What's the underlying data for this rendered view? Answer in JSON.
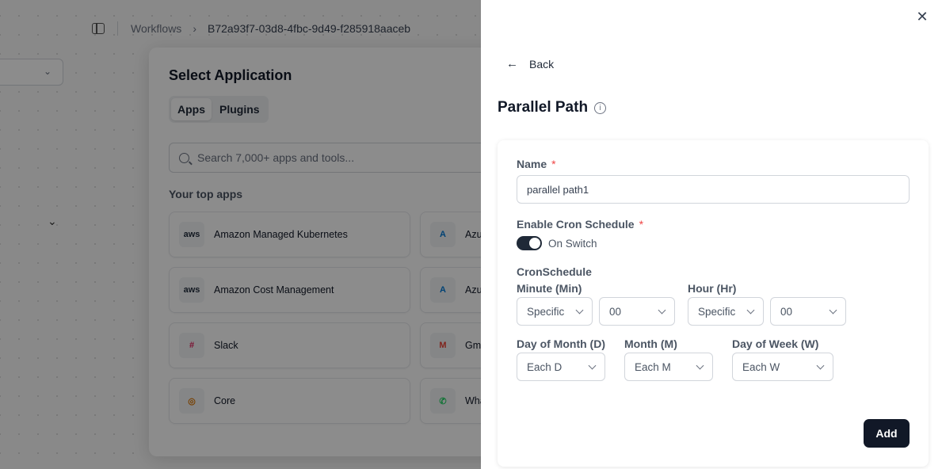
{
  "breadcrumb": {
    "workflows": "Workflows",
    "separator": "›",
    "workflow_id": "B72a93f7-03d8-4fbc-9d49-f285918aaceb"
  },
  "modal": {
    "title": "Select Application",
    "tabs": [
      {
        "label": "Apps"
      },
      {
        "label": "Plugins"
      }
    ],
    "search_placeholder": "Search 7,000+ apps and tools...",
    "top_apps_label": "Your top apps",
    "apps": [
      {
        "name": "Amazon Managed Kubernetes",
        "icon_text": "aws"
      },
      {
        "name": "Azu",
        "icon_text": "A"
      },
      {
        "name": "Amazon Cost Management",
        "icon_text": "aws"
      },
      {
        "name": "Azu",
        "icon_text": "A"
      },
      {
        "name": "Slack",
        "icon_text": "#"
      },
      {
        "name": "Gm",
        "icon_text": "M"
      },
      {
        "name": "Core",
        "icon_text": "◎"
      },
      {
        "name": "Wha",
        "icon_text": "✆"
      }
    ]
  },
  "panel": {
    "close": "✕",
    "back_label": "Back",
    "back_arrow": "←",
    "title": "Parallel Path",
    "info_glyph": "i",
    "form": {
      "name_label": "Name",
      "required_mark": "*",
      "name_value": "parallel path1",
      "cron_label": "Enable Cron Schedule",
      "switch_label": "On Switch",
      "switch_on": true,
      "cron_schedule_label": "CronSchedule",
      "minute_label": "Minute (Min)",
      "minute_mode": "Specific",
      "minute_value": "00",
      "hour_label": "Hour (Hr)",
      "hour_mode": "Specific",
      "hour_value": "00",
      "dom_label": "Day of Month (D)",
      "dom_value": "Each D",
      "month_label": "Month (M)",
      "month_value": "Each M",
      "dow_label": "Day of Week (W)",
      "dow_value": "Each W",
      "add_button": "Add"
    }
  },
  "colors": {
    "primary": "#111827",
    "required": "#ef4444",
    "overlay": "rgba(0,0,0,0.45)"
  }
}
